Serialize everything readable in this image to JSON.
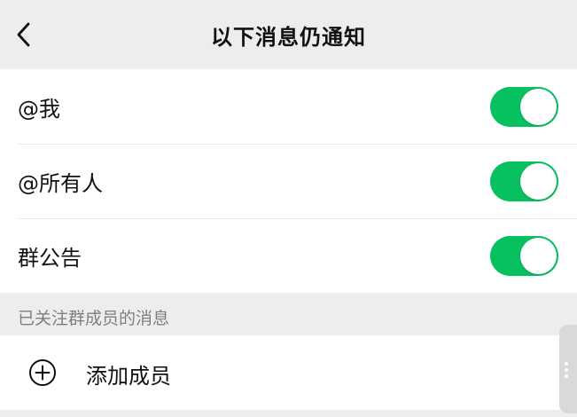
{
  "header": {
    "title": "以下消息仍通知",
    "back_icon": "chevron-left-icon"
  },
  "settings": {
    "items": [
      {
        "label": "@我",
        "enabled": true
      },
      {
        "label": "@所有人",
        "enabled": true
      },
      {
        "label": "群公告",
        "enabled": true
      }
    ]
  },
  "followed_section": {
    "header": "已关注群成员的消息",
    "add_label": "添加成员",
    "add_icon": "plus-circle-icon"
  },
  "colors": {
    "accent": "#07c160",
    "background": "#ededed",
    "card": "#ffffff",
    "secondary_text": "#7f7f7f"
  }
}
